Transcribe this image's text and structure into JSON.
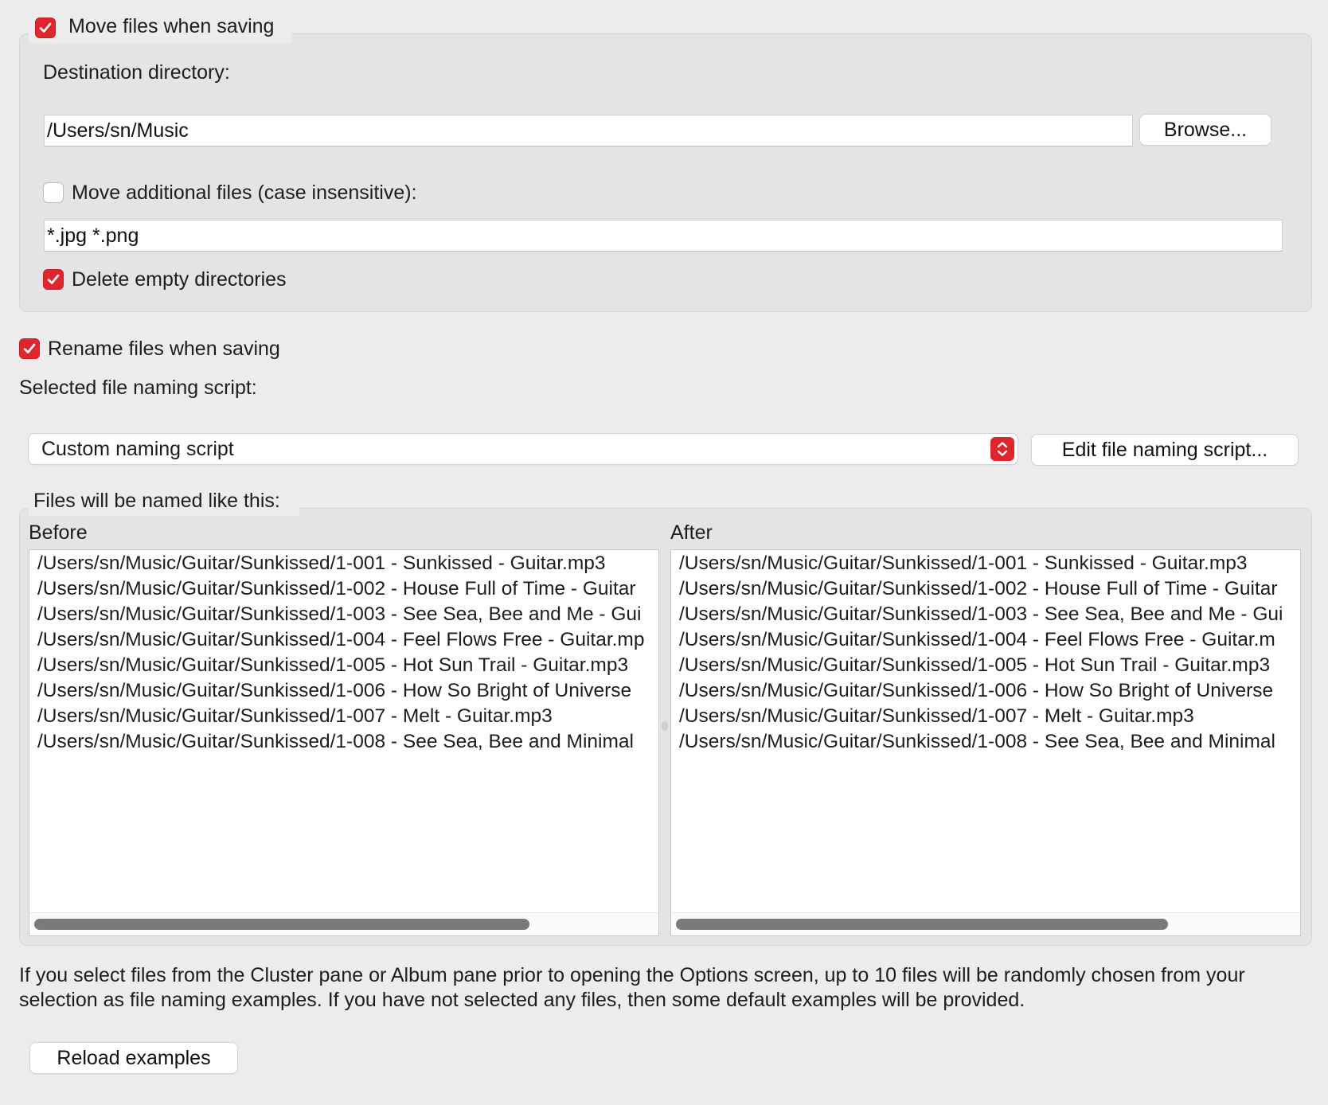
{
  "move_files": {
    "checkbox_label": "Move files when saving",
    "checked": true,
    "destination_label": "Destination directory:",
    "destination_value": "/Users/sn/Music",
    "browse_label": "Browse...",
    "additional": {
      "label": "Move additional files (case insensitive):",
      "checked": false,
      "patterns_value": "*.jpg *.png"
    },
    "delete_empty": {
      "label": "Delete empty directories",
      "checked": true
    }
  },
  "rename_files": {
    "checkbox_label": "Rename files when saving",
    "checked": true,
    "script_label": "Selected file naming script:",
    "script_selected": "Custom naming script",
    "edit_button_label": "Edit file naming script..."
  },
  "examples": {
    "group_title": "Files will be named like this:",
    "before_header": "Before",
    "after_header": "After",
    "before_items": [
      "/Users/sn/Music/Guitar/Sunkissed/1-001 - Sunkissed - Guitar.mp3",
      "/Users/sn/Music/Guitar/Sunkissed/1-002 - House Full of Time - Guitar",
      "/Users/sn/Music/Guitar/Sunkissed/1-003 - See Sea, Bee and Me - Gui",
      "/Users/sn/Music/Guitar/Sunkissed/1-004 - Feel Flows Free - Guitar.mp",
      "/Users/sn/Music/Guitar/Sunkissed/1-005 - Hot Sun Trail - Guitar.mp3",
      "/Users/sn/Music/Guitar/Sunkissed/1-006 - How So Bright of Universe",
      "/Users/sn/Music/Guitar/Sunkissed/1-007 - Melt - Guitar.mp3",
      "/Users/sn/Music/Guitar/Sunkissed/1-008 - See Sea, Bee and Minimal"
    ],
    "after_items": [
      "/Users/sn/Music/Guitar/Sunkissed/1-001 - Sunkissed - Guitar.mp3",
      "/Users/sn/Music/Guitar/Sunkissed/1-002 - House Full of Time - Guitar",
      "/Users/sn/Music/Guitar/Sunkissed/1-003 - See Sea, Bee and Me - Gui",
      "/Users/sn/Music/Guitar/Sunkissed/1-004 - Feel Flows Free - Guitar.m",
      "/Users/sn/Music/Guitar/Sunkissed/1-005 - Hot Sun Trail - Guitar.mp3",
      "/Users/sn/Music/Guitar/Sunkissed/1-006 - How So Bright of Universe",
      "/Users/sn/Music/Guitar/Sunkissed/1-007 - Melt - Guitar.mp3",
      "/Users/sn/Music/Guitar/Sunkissed/1-008 - See Sea, Bee and Minimal"
    ]
  },
  "info_text": "If you select files from the Cluster pane or Album pane prior to opening the Options screen, up to 10 files will be randomly chosen from your selection as file naming examples.  If you have not selected any files, then some default examples will be provided.",
  "reload_button_label": "Reload examples",
  "colors": {
    "accent": "#e0262d",
    "window_bg": "#ececec",
    "group_bg": "#e4e4e4"
  },
  "icons": {
    "checkmark": "checkmark-icon",
    "stepper": "up-down-chevron-icon"
  }
}
